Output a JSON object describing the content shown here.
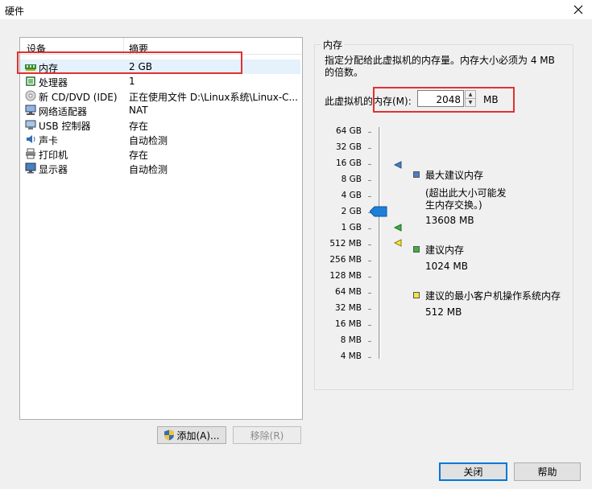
{
  "window": {
    "title": "硬件"
  },
  "device_list": {
    "columns": [
      "设备",
      "摘要"
    ],
    "rows": [
      {
        "name": "内存",
        "summary": "2 GB",
        "icon": "memory-icon"
      },
      {
        "name": "处理器",
        "summary": "1",
        "icon": "processor-icon"
      },
      {
        "name": "新 CD/DVD (IDE)",
        "summary": "正在使用文件 D:\\Linux系统\\Linux-C...",
        "icon": "cd-dvd-icon"
      },
      {
        "name": "网络适配器",
        "summary": "NAT",
        "icon": "network-adapter-icon"
      },
      {
        "name": "USB 控制器",
        "summary": "存在",
        "icon": "usb-icon"
      },
      {
        "name": "声卡",
        "summary": "自动检测",
        "icon": "sound-card-icon"
      },
      {
        "name": "打印机",
        "summary": "存在",
        "icon": "printer-icon"
      },
      {
        "name": "显示器",
        "summary": "自动检测",
        "icon": "display-icon"
      }
    ],
    "selected_index": 0
  },
  "buttons": {
    "add": "添加(A)...",
    "remove": "移除(R)",
    "close": "关闭",
    "help": "帮助"
  },
  "memory": {
    "group_title": "内存",
    "description": "指定分配给此虚拟机的内存量。内存大小必须为 4 MB 的倍数。",
    "label": "此虚拟机的内存(M):",
    "value": "2048",
    "unit": "MB",
    "scale": [
      "64 GB",
      "32 GB",
      "16 GB",
      "8 GB",
      "4 GB",
      "2 GB",
      "1 GB",
      "512 MB",
      "256 MB",
      "128 MB",
      "64 MB",
      "32 MB",
      "16 MB",
      "8 MB",
      "4 MB"
    ],
    "current_level": "2 GB",
    "legend": [
      {
        "title": "最大建议内存",
        "note": "(超出此大小可能发生内存交换。)",
        "value": "13608 MB",
        "color": "#4a7fc1"
      },
      {
        "title": "建议内存",
        "value": "1024 MB",
        "color": "#3cb043"
      },
      {
        "title": "建议的最小客户机操作系统内存",
        "value": "512 MB",
        "color": "#f5e642"
      }
    ]
  }
}
